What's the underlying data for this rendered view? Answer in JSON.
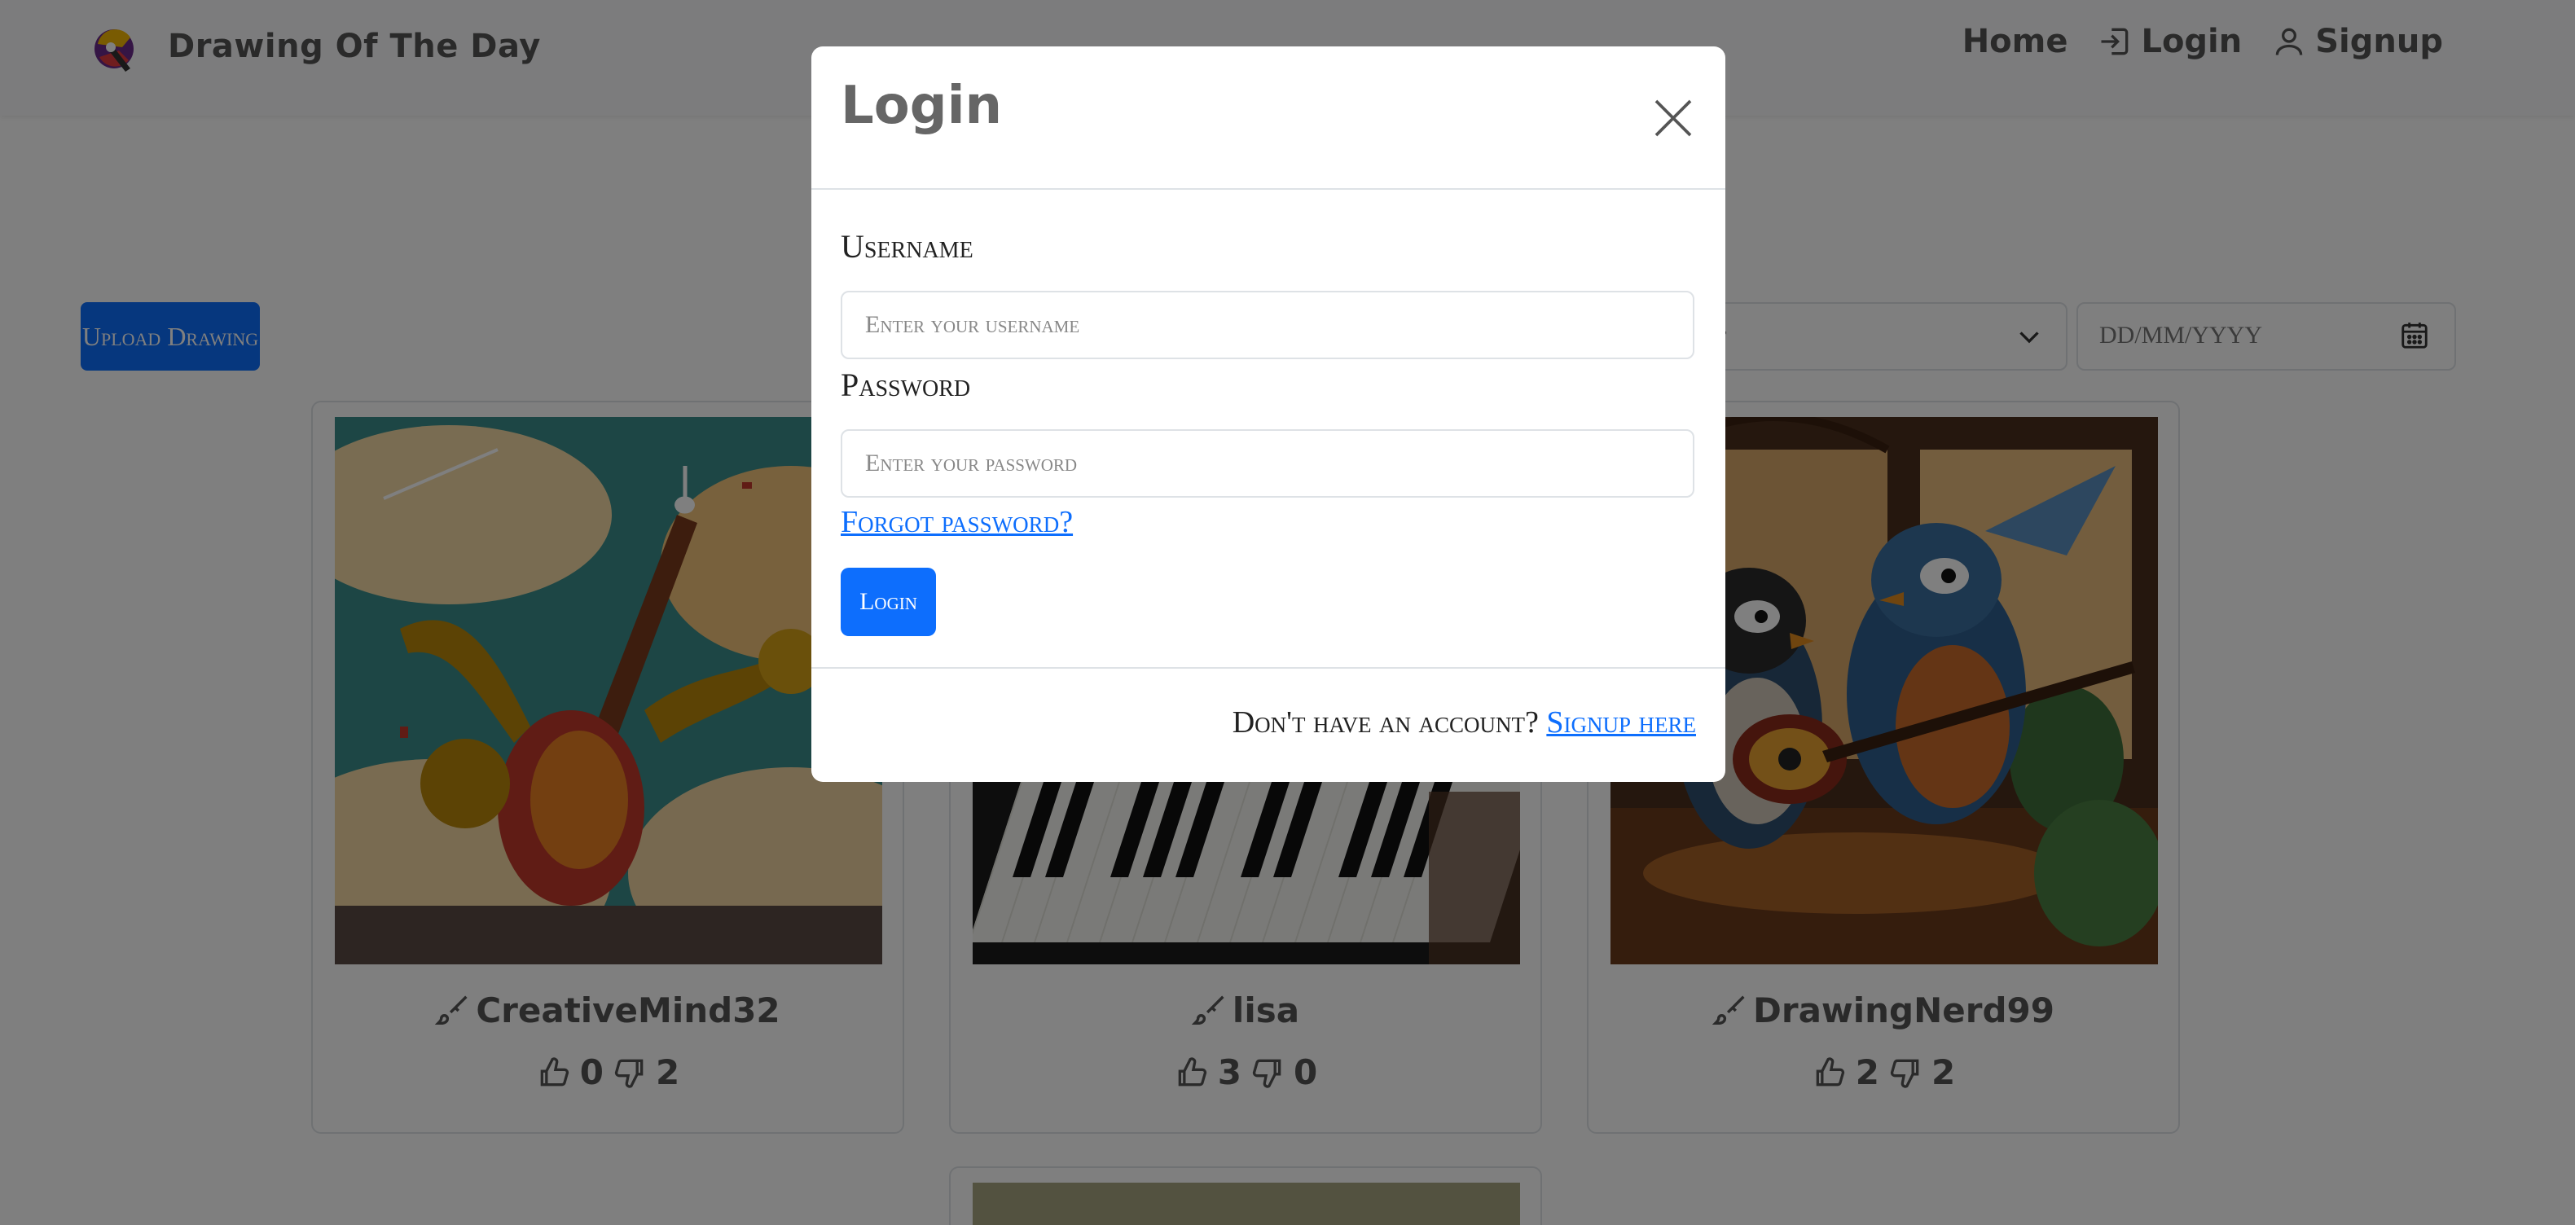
{
  "navbar": {
    "brand": "Drawing Of The Day",
    "links": [
      {
        "label": "Home",
        "icon": "home"
      },
      {
        "label": "Login",
        "icon": "login-icon"
      },
      {
        "label": "Signup",
        "icon": "user-icon"
      }
    ]
  },
  "toolbar": {
    "upload_label": "Upload Drawing",
    "sort_value": "st",
    "date_placeholder": "DD/MM/YYYY"
  },
  "cards": [
    {
      "author": "CreativeMind32",
      "likes": "0",
      "dislikes": "2",
      "image": "music instruments explosion"
    },
    {
      "author": "lisa",
      "likes": "3",
      "dislikes": "0",
      "image": "piano keys"
    },
    {
      "author": "DrawingNerd99",
      "likes": "2",
      "dislikes": "2",
      "image": "birds playing guitar"
    }
  ],
  "modal": {
    "title": "Login",
    "username_label": "Username",
    "username_placeholder": "Enter your username",
    "password_label": "Password",
    "password_placeholder": "Enter your password",
    "forgot_label": "Forgot password?",
    "login_button": "Login",
    "footer_text": "Don't have an account?",
    "signup_link": "Signup here"
  },
  "colors": {
    "accent": "#0d6efd",
    "backdrop": "rgba(0,0,0,0.5)"
  }
}
